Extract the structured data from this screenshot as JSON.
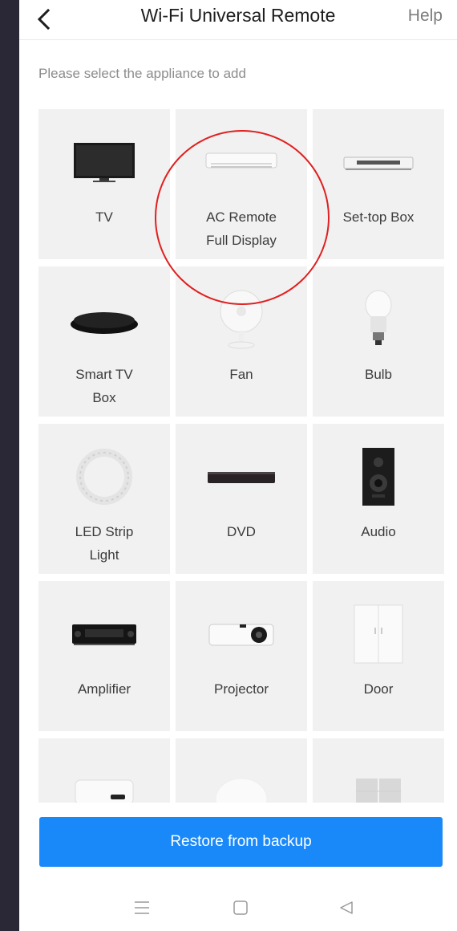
{
  "header": {
    "title": "Wi-Fi Universal Remote",
    "help_label": "Help",
    "back_icon": "chevron-left-icon"
  },
  "subtitle": "Please select the appliance to add",
  "appliances": [
    {
      "label": "TV",
      "icon": "tv-icon"
    },
    {
      "label": "AC Remote\nFull Display",
      "icon": "air-conditioner-icon"
    },
    {
      "label": "Set-top Box",
      "icon": "set-top-box-icon"
    },
    {
      "label": "Smart TV\nBox",
      "icon": "smart-tv-box-icon"
    },
    {
      "label": "Fan",
      "icon": "fan-icon"
    },
    {
      "label": "Bulb",
      "icon": "bulb-icon"
    },
    {
      "label": "LED Strip\nLight",
      "icon": "led-strip-icon"
    },
    {
      "label": "DVD",
      "icon": "dvd-icon"
    },
    {
      "label": "Audio",
      "icon": "speaker-icon"
    },
    {
      "label": "Amplifier",
      "icon": "amplifier-icon"
    },
    {
      "label": "Projector",
      "icon": "projector-icon"
    },
    {
      "label": "Door",
      "icon": "door-icon"
    },
    {
      "label": "",
      "icon": "water-heater-icon"
    },
    {
      "label": "",
      "icon": "humidifier-icon"
    },
    {
      "label": "",
      "icon": "switch-icon"
    }
  ],
  "restore_button": {
    "label": "Restore from backup",
    "color": "#1989fa"
  },
  "navbar": {
    "menu_icon": "menu-icon",
    "home_icon": "home-square-icon",
    "back_icon": "back-triangle-icon"
  },
  "colors": {
    "highlight": "#e02020",
    "cell_bg": "#f1f1f1"
  }
}
